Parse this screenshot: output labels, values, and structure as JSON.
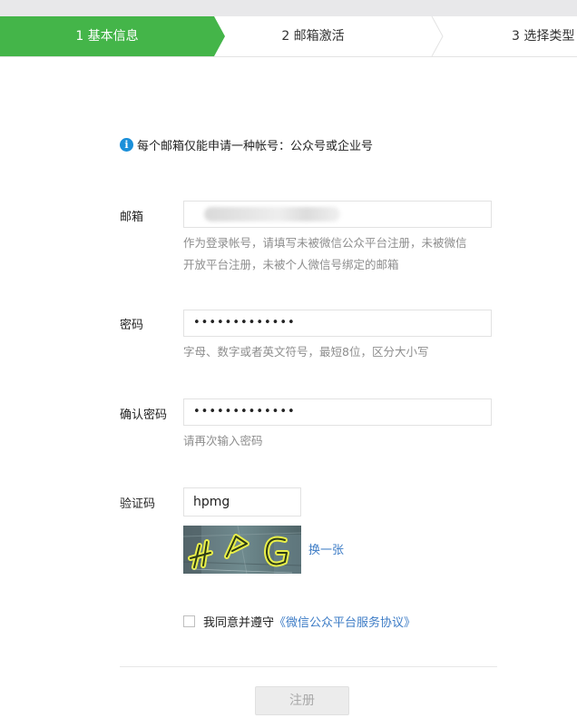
{
  "steps": [
    {
      "label": "1 基本信息",
      "active": true
    },
    {
      "label": "2 邮箱激活",
      "active": false
    },
    {
      "label": "3 选择类型",
      "active": false
    }
  ],
  "colors": {
    "accent": "#44b549",
    "link": "#3d7cc6",
    "info": "#1a8fd9",
    "hint": "#8d8d8d"
  },
  "notice": {
    "icon": "info-icon",
    "text": "每个邮箱仅能申请一种帐号：公众号或企业号"
  },
  "form": {
    "email": {
      "label": "邮箱",
      "value": "",
      "hint": "作为登录帐号，请填写未被微信公众平台注册，未被微信开放平台注册，未被个人微信号绑定的邮箱"
    },
    "password": {
      "label": "密码",
      "value": "•••••••••••••",
      "hint": "字母、数字或者英文符号，最短8位，区分大小写"
    },
    "confirm": {
      "label": "确认密码",
      "value": "•••••••••••••",
      "hint": "请再次输入密码"
    },
    "captcha": {
      "label": "验证码",
      "value": "hpmg",
      "refresh": "换一张"
    },
    "agreement": {
      "checked": false,
      "text": "我同意并遵守",
      "link": "《微信公众平台服务协议》"
    },
    "submit": "注册"
  }
}
